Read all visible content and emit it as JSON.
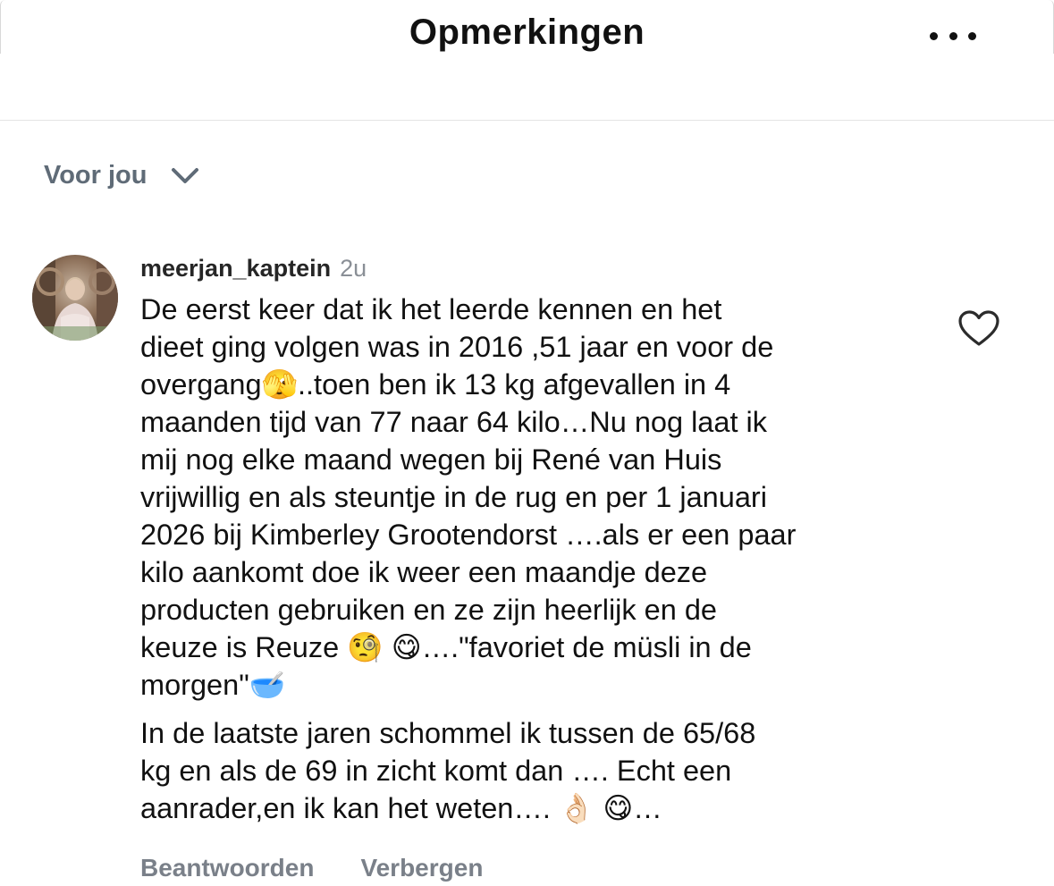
{
  "header": {
    "title": "Opmerkingen",
    "more_icon": "more-horizontal-icon"
  },
  "sort": {
    "label": "Voor jou",
    "icon": "chevron-down-icon"
  },
  "comment": {
    "username": "meerjan_kaptein",
    "time": "2u",
    "paragraph_1": "De eerst keer dat ik het leerde kennen en het\ndieet ging volgen was in 2016 ,51 jaar en voor de\novergang🫣..toen ben ik 13 kg afgevallen in 4\nmaanden tijd van 77 naar 64 kilo…Nu nog laat ik\nmij nog elke maand wegen bij René van Huis\nvrijwillig en als steuntje in de rug en per 1 januari\n2026 bij Kimberley Grootendorst ….als er een paar\nkilo aankomt doe ik weer een maandje deze\nproducten gebruiken en ze zijn heerlijk en de\nkeuze is Reuze 🧐 😋….\"favoriet de müsli in de\nmorgen\"🥣",
    "paragraph_2": "In de laatste jaren schommel ik tussen de 65/68\nkg en als de 69 in zicht komt dan …. Echt een\naanrader,en ik kan het weten…. 👌🏻 😋…",
    "like_icon": "heart-outline-icon"
  },
  "actions": {
    "reply": "Beantwoorden",
    "hide": "Verbergen"
  },
  "colors": {
    "background": "#ffffff",
    "text_primary": "#111111",
    "text_secondary": "#8a8f96",
    "sort_label": "#5f6b77",
    "action_label": "#7a8089",
    "divider": "#e4e4e4"
  }
}
